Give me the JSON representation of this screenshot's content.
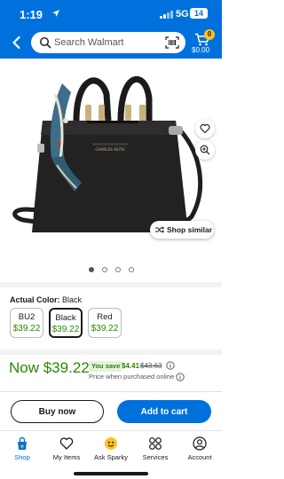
{
  "status_bar": {
    "time": "1:19",
    "network": "5G",
    "battery": "14"
  },
  "header": {
    "search_placeholder": "Search Walmart",
    "cart_count": "0",
    "cart_total": "$0.00"
  },
  "product_image": {
    "shop_similar": "Shop similar",
    "brand_print": "CHARLES KEITH",
    "carousel_pages": 4,
    "active_page": 1
  },
  "colors": {
    "accent": "#0071dc",
    "price_green": "#2a8703",
    "badge_yellow": "#ffc220"
  },
  "variant_selector": {
    "label": "Actual Color:",
    "selected": "Black",
    "options": [
      {
        "name": "BU2",
        "price": "$39.22"
      },
      {
        "name": "Black",
        "price": "$39.22"
      },
      {
        "name": "Red",
        "price": "$39.22"
      }
    ]
  },
  "price": {
    "now": "Now $39.22",
    "save_label": "You save",
    "save_amount": "$4.41",
    "was": "$43.63",
    "note": "Price when purchased online"
  },
  "actions": {
    "buy_now": "Buy now",
    "add_to_cart": "Add to cart"
  },
  "bottom_nav": [
    {
      "label": "Shop",
      "icon": "shop-icon"
    },
    {
      "label": "My Items",
      "icon": "heart-icon"
    },
    {
      "label": "Ask Sparky",
      "icon": "sparky-icon"
    },
    {
      "label": "Services",
      "icon": "services-icon"
    },
    {
      "label": "Account",
      "icon": "account-icon"
    }
  ]
}
